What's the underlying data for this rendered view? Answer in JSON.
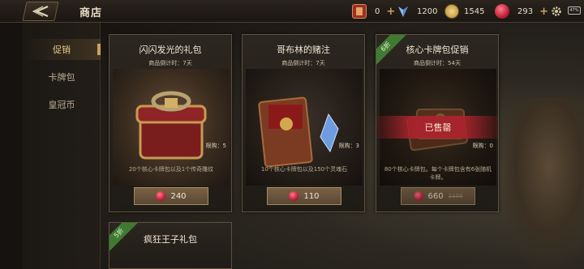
{
  "header": {
    "title": "商店"
  },
  "resources": [
    {
      "icon": "card-ticket-icon",
      "value": "0",
      "plus": "+"
    },
    {
      "icon": "crystal-icon",
      "value": "1200"
    },
    {
      "icon": "gold-coin-icon",
      "value": "1545"
    },
    {
      "icon": "ruby-crown-icon",
      "value": "293",
      "plus": "+"
    }
  ],
  "status": {
    "battery": "47%"
  },
  "sidebar": {
    "items": [
      {
        "label": "促销",
        "active": true
      },
      {
        "label": "卡牌包"
      },
      {
        "label": "皇冠币"
      }
    ]
  },
  "cards": [
    {
      "title": "闪闪发光的礼包",
      "timer": "商品倒计时：7天",
      "limit": "限购：5",
      "desc": "20个核心卡牌包以及1个传奇雕纹",
      "price": "240"
    },
    {
      "title": "哥布林的赌注",
      "timer": "商品倒计时：7天",
      "limit": "限购：3",
      "desc": "10个核心卡牌包以及150个灵魂石",
      "price": "110"
    },
    {
      "title": "核心卡牌包促销",
      "timer": "商品倒计时：54天",
      "limit": "限购：0",
      "desc": "80个核心卡牌包。每个卡牌包含有6张随机卡牌。",
      "price": "660",
      "old_price": "1100",
      "ribbon": "6折",
      "soldout": "已售罄"
    }
  ],
  "card_bottom": {
    "title": "疯狂王子礼包",
    "ribbon": "5折"
  },
  "colors": {
    "accent": "#c9a45c",
    "soldout": "#aa232d",
    "ribbon": "#3f7a32"
  }
}
